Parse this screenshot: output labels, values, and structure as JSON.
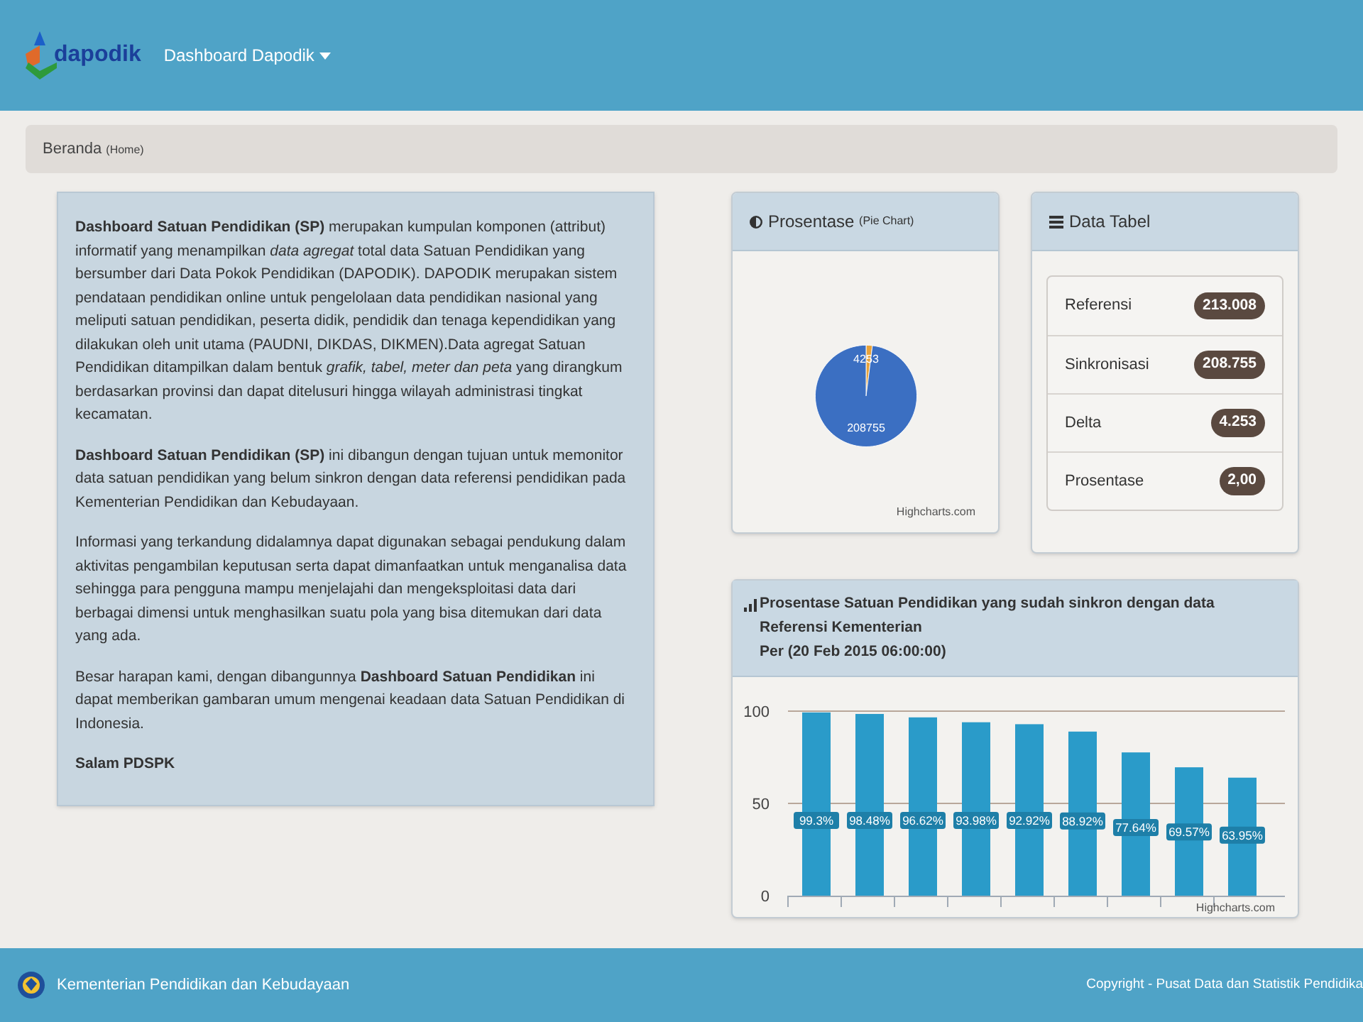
{
  "header": {
    "logo_text": "dapodik",
    "menu": "Dashboard Dapodik"
  },
  "breadcrumb": {
    "label": "Beranda",
    "sub": "(Home)"
  },
  "intro": {
    "paragraphs": [
      "**Dashboard Satuan Pendidikan (SP)** merupakan kumpulan komponen (attribut) informatif yang menampilkan *data agregat* total data Satuan Pendidikan yang bersumber dari Data Pokok Pendidikan (DAPODIK). DAPODIK merupakan sistem pendataan pendidikan online untuk pengelolaan data pendidikan nasional yang meliputi satuan pendidikan, peserta didik, pendidik dan tenaga kependidikan yang dilakukan oleh unit utama (PAUDNI, DIKDAS, DIKMEN).Data agregat Satuan Pendidikan ditampilkan dalam bentuk *grafik, tabel, meter dan peta* yang dirangkum berdasarkan provinsi dan dapat ditelusuri hingga wilayah administrasi tingkat kecamatan.",
      "**Dashboard Satuan Pendidikan (SP)** ini dibangun dengan tujuan untuk memonitor data satuan pendidikan yang belum sinkron dengan data referensi pendidikan pada Kementerian Pendidikan dan Kebudayaan.",
      "Informasi yang terkandung didalamnya dapat digunakan sebagai pendukung dalam aktivitas pengambilan keputusan serta dapat dimanfaatkan untuk menganalisa data sehingga para pengguna mampu menjelajahi dan mengeksploitasi data dari berbagai dimensi untuk menghasilkan suatu pola yang bisa ditemukan dari data yang ada.",
      "Besar harapan kami, dengan dibangunnya **Dashboard Satuan Pendidikan** ini dapat memberikan gambaran umum mengenai keadaan data Satuan Pendidikan di Indonesia."
    ],
    "signature": "Salam PDSPK"
  },
  "pie_panel": {
    "title": "Prosentase",
    "title_note": "(Pie Chart)",
    "credit": "Highcharts.com",
    "chart_data": {
      "type": "pie",
      "series": [
        {
          "values": [
            4253,
            208755
          ]
        }
      ],
      "colors": [
        "#e8a33a",
        "#3b6fc2"
      ],
      "data_labels": true
    }
  },
  "table_panel": {
    "title": "Data Tabel",
    "rows": [
      {
        "label": "Referensi",
        "value": "213.008"
      },
      {
        "label": "Sinkronisasi",
        "value": "208.755"
      },
      {
        "label": "Delta",
        "value": "4.253"
      },
      {
        "label": "Prosentase",
        "value": "2,00"
      }
    ]
  },
  "bar_panel": {
    "title": "Prosentase Satuan Pendidikan yang sudah sinkron dengan data Referensi Kementerian",
    "subtitle": "Per (20 Feb 2015 06:00:00)",
    "credit": "Highcharts.com",
    "chart_data": {
      "type": "bar",
      "series": [
        {
          "color": "#2a9bc9",
          "values": [
            99.3,
            98.48,
            96.62,
            93.98,
            92.92,
            88.92,
            77.64,
            69.57,
            63.95
          ]
        }
      ],
      "ylim": [
        0,
        100
      ],
      "yticks": [
        0,
        50,
        100
      ],
      "value_labels": [
        "99.3%",
        "98.48%",
        "96.62%",
        "93.98%",
        "92.92%",
        "88.92%",
        "77.64%",
        "69.57%",
        "63.95%"
      ]
    }
  },
  "footer": {
    "ministry": "Kementerian Pendidikan dan Kebudayaan",
    "copyright": "Copyright - Pusat Data dan Statistik Pendidika"
  }
}
